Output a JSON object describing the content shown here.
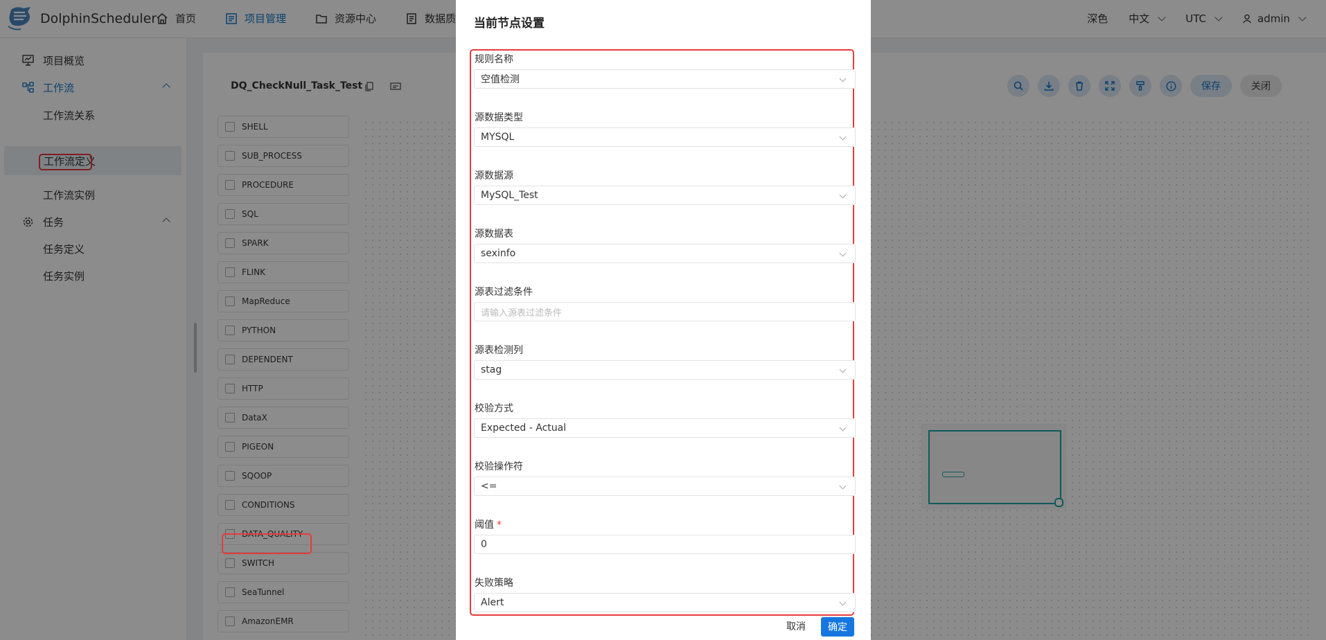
{
  "app": {
    "name": "DolphinScheduler"
  },
  "nav": {
    "items": [
      {
        "label": "首页",
        "icon": "home-icon"
      },
      {
        "label": "项目管理",
        "icon": "project-icon",
        "active": true
      },
      {
        "label": "资源中心",
        "icon": "folder-icon"
      },
      {
        "label": "数据质量",
        "icon": "data-quality-icon"
      }
    ],
    "theme": "深色",
    "language": "中文",
    "timezone": "UTC",
    "user": "admin"
  },
  "sidebar": {
    "items": [
      {
        "label": "项目概览"
      },
      {
        "label": "工作流"
      },
      {
        "label": "工作流关系"
      },
      {
        "label": "工作流定义"
      },
      {
        "label": "工作流实例"
      },
      {
        "label": "任务"
      },
      {
        "label": "任务定义"
      },
      {
        "label": "任务实例"
      }
    ]
  },
  "workflow": {
    "name": "DQ_CheckNull_Task_Test",
    "save_label": "保存",
    "close_label": "关闭"
  },
  "palette": {
    "items": [
      "SHELL",
      "SUB_PROCESS",
      "PROCEDURE",
      "SQL",
      "SPARK",
      "FLINK",
      "MapReduce",
      "PYTHON",
      "DEPENDENT",
      "HTTP",
      "DataX",
      "PIGEON",
      "SQOOP",
      "CONDITIONS",
      "DATA_QUALITY",
      "SWITCH",
      "SeaTunnel",
      "AmazonEMR"
    ]
  },
  "modal": {
    "title": "当前节点设置",
    "fields": [
      {
        "label": "规则名称",
        "value": "空值检测"
      },
      {
        "label": "源数据类型",
        "value": "MYSQL"
      },
      {
        "label": "源数据源",
        "value": "MySQL_Test"
      },
      {
        "label": "源数据表",
        "value": "sexinfo"
      },
      {
        "label": "源表过滤条件",
        "placeholder": "请输入源表过滤条件"
      },
      {
        "label": "源表检测列",
        "value": "stag"
      },
      {
        "label": "校验方式",
        "value": "Expected - Actual"
      },
      {
        "label": "校验操作符",
        "value": "<="
      },
      {
        "label": "阈值",
        "value": "0",
        "required_mark": "*"
      },
      {
        "label": "失败策略",
        "value": "Alert"
      }
    ],
    "cancel_label": "取消",
    "ok_label": "确定"
  },
  "colors": {
    "accent": "#1677c8",
    "highlight": "#e83a3a",
    "minimap": "#1ea3a3"
  }
}
